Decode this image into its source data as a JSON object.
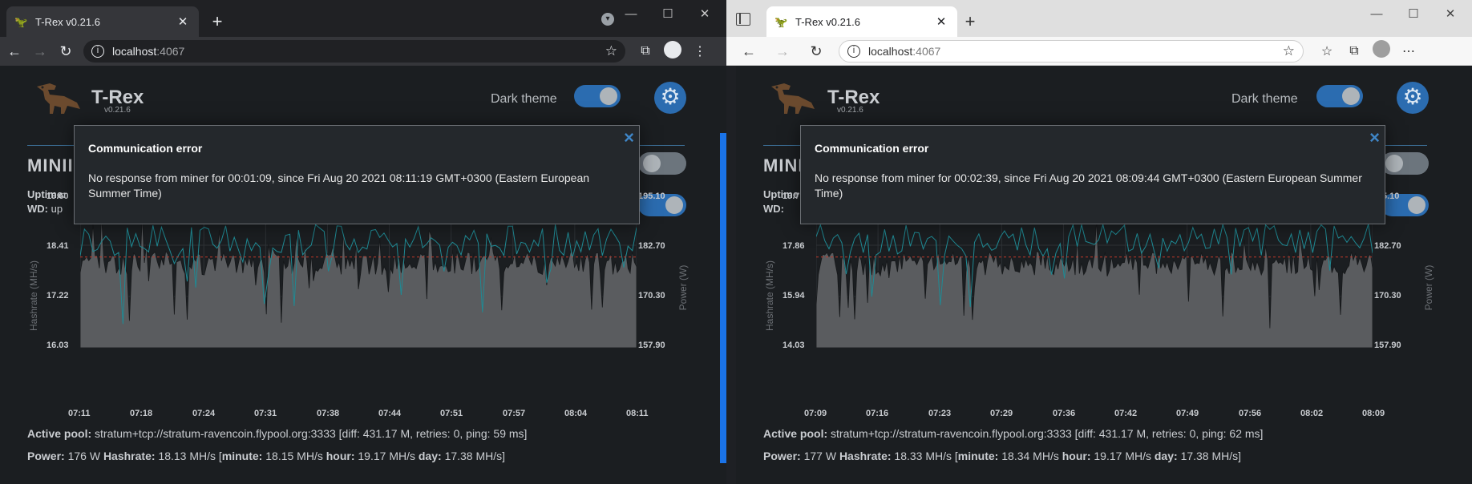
{
  "left_window": {
    "tab_title": "T-Rex v0.21.6",
    "address_host": "localhost",
    "address_port": ":4067",
    "app": {
      "brand": "T-Rex",
      "version": "v0.21.6",
      "dark_theme_label": "Dark theme",
      "section_title_partial": "MINII",
      "uptime_label": "Uptime:",
      "wd_label": "WD:",
      "wd_value_partial": "up",
      "y_left_label": "Hashrate (MH/s)",
      "y_right_label": "Power (W)",
      "y_left_ticks": [
        "19.60",
        "18.41",
        "17.22",
        "16.03"
      ],
      "y_right_ticks": [
        "195.10",
        "182.70",
        "170.30",
        "157.90"
      ],
      "x_ticks": [
        "07:11",
        "07:18",
        "07:24",
        "07:31",
        "07:38",
        "07:44",
        "07:51",
        "07:57",
        "08:04",
        "08:11"
      ],
      "active_pool_label": "Active pool:",
      "active_pool_value": "stratum+tcp://stratum-ravencoin.flypool.org:3333",
      "pool_stats": "[diff: 431.17 M, retries: 0, ping: 59 ms]",
      "power_label": "Power:",
      "power_value": "176 W",
      "hashrate_label": "Hashrate:",
      "hashrate_value": "18.13 MH/s",
      "minute_label": "minute:",
      "minute_value": "18.15 MH/s",
      "hour_label": "hour:",
      "hour_value": "19.17 MH/s",
      "day_label": "day:",
      "day_value": "17.38 MH/s"
    },
    "modal": {
      "title": "Communication error",
      "body": "No response from miner for 00:01:09, since Fri Aug 20 2021 08:11:19 GMT+0300 (Eastern European Summer Time)",
      "close_glyph": "×"
    }
  },
  "right_window": {
    "tab_title": "T-Rex v0.21.6",
    "address_host": "localhost",
    "address_port": ":4067",
    "app": {
      "brand": "T-Rex",
      "version": "v0.21.6",
      "dark_theme_label": "Dark theme",
      "section_title_partial": "MINI",
      "uptime_label": "Uptime",
      "wd_label": "WD:",
      "y_left_label": "Hashrate (MH/s)",
      "y_right_label": "Power (W)",
      "y_left_ticks": [
        "19.7",
        "17.86",
        "15.94",
        "14.03"
      ],
      "y_right_ticks": [
        "5.10",
        "182.70",
        "170.30",
        "157.90"
      ],
      "x_ticks": [
        "07:09",
        "07:16",
        "07:23",
        "07:29",
        "07:36",
        "07:42",
        "07:49",
        "07:56",
        "08:02",
        "08:09"
      ],
      "active_pool_label": "Active pool:",
      "active_pool_value": "stratum+tcp://stratum-ravencoin.flypool.org:3333",
      "pool_stats": "[diff: 431.17 M, retries: 0, ping: 62 ms]",
      "power_label": "Power:",
      "power_value": "177 W",
      "hashrate_label": "Hashrate:",
      "hashrate_value": "18.33 MH/s",
      "minute_label": "minute:",
      "minute_value": "18.34 MH/s",
      "hour_label": "hour:",
      "hour_value": "19.17 MH/s",
      "day_label": "day:",
      "day_value": "17.38 MH/s"
    },
    "modal": {
      "title": "Communication error",
      "body": "No response from miner for 00:02:39, since Fri Aug 20 2021 08:09:44 GMT+0300 (Eastern European Summer Time)",
      "close_glyph": "×"
    }
  },
  "colors": {
    "accent": "#2b6cb0",
    "modal_close": "#3f86c7",
    "hashrate_area": "#5a5c5f",
    "power_line": "#1f8a94",
    "avg_line": "#c0392b"
  },
  "icons": [
    "trex-logo-icon",
    "gear-icon",
    "close-icon",
    "info-icon",
    "star-icon",
    "extensions-icon",
    "back-icon",
    "forward-icon",
    "reload-icon",
    "menu-icon"
  ]
}
